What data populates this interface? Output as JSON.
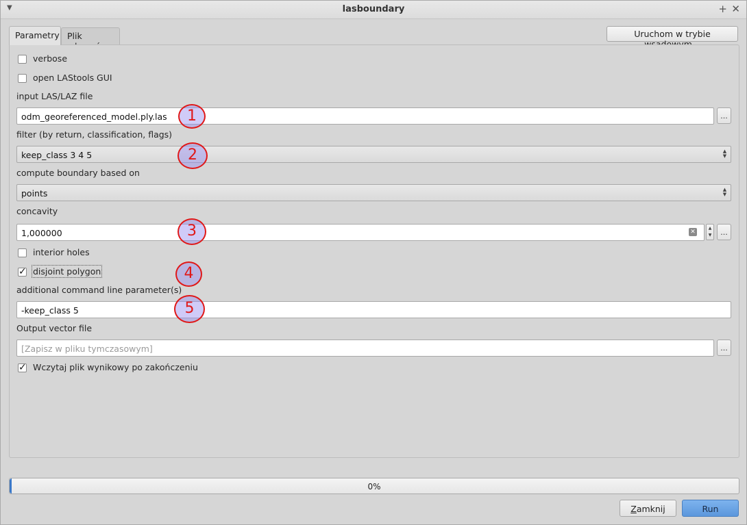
{
  "window": {
    "title": "lasboundary",
    "menu_icon": "chevron-down-icon",
    "plus_glyph": "+",
    "close_glyph": "✕"
  },
  "tabs": [
    {
      "label": "Parametry",
      "active": true
    },
    {
      "label": "Plik zdarzeń",
      "active": false
    }
  ],
  "batch_button_label": "Uruchom w trybie wsadowym...",
  "params": {
    "verbose": {
      "label": "verbose",
      "checked": false
    },
    "open_gui": {
      "label": "open LAStools GUI",
      "checked": false
    },
    "input_file": {
      "label": "input LAS/LAZ file",
      "value": "odm_georeferenced_model.ply.las",
      "browse": "..."
    },
    "filter": {
      "label": "filter (by return, classification, flags)",
      "value": "keep_class 3 4 5"
    },
    "boundary": {
      "label": "compute boundary based on",
      "value": "points"
    },
    "concavity": {
      "label": "concavity",
      "value": "1,000000",
      "browse": "..."
    },
    "interior_holes": {
      "label": "interior holes",
      "checked": false
    },
    "disjoint": {
      "label": "disjoint polygon",
      "checked": true
    },
    "additional": {
      "label": "additional command line parameter(s)",
      "value": "-keep_class 5"
    },
    "output": {
      "label": "Output vector file",
      "placeholder": "[Zapisz w pliku tymczasowym]",
      "browse": "..."
    },
    "load_result": {
      "label": "Wczytaj plik wynikowy po zakończeniu",
      "checked": true
    }
  },
  "annotations": [
    "1",
    "2",
    "3",
    "4",
    "5"
  ],
  "annotation_color": "#e01818",
  "progress": {
    "percent": 0,
    "text": "0%"
  },
  "buttons": {
    "close_mnemonic": "Z",
    "close_rest": "amknij",
    "run": "Run"
  },
  "glyphs": {
    "tick": "✓",
    "up": "▲",
    "down": "▼",
    "clear": "✕"
  }
}
